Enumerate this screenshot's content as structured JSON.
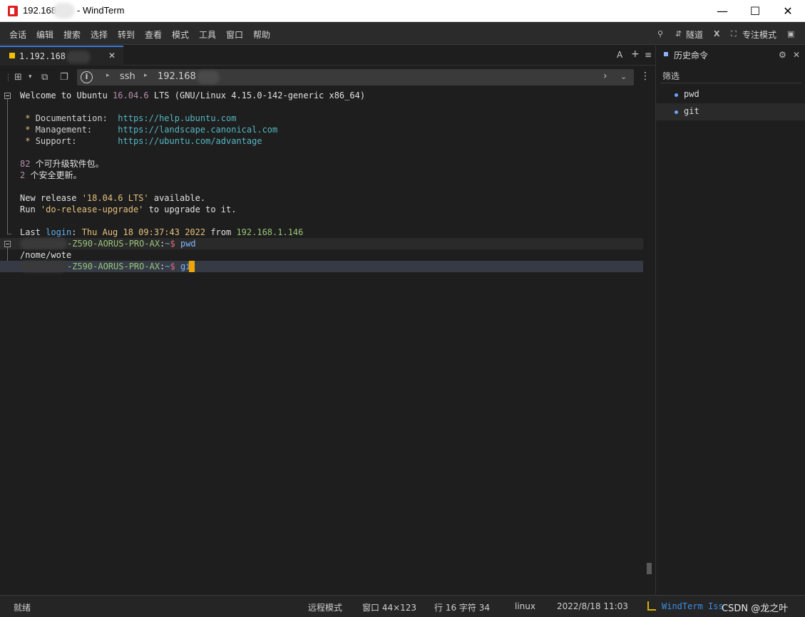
{
  "window": {
    "title_prefix": "192.168",
    "title_suffix": "- WindTerm",
    "minimize": "—",
    "maximize": "☐",
    "close": "✕"
  },
  "menu": {
    "items": [
      "会话",
      "编辑",
      "搜索",
      "选择",
      "转到",
      "查看",
      "模式",
      "工具",
      "窗口",
      "帮助"
    ],
    "tunnel_label": "隧道",
    "focus_label": "专注模式"
  },
  "tab": {
    "label": "1.192.168",
    "close": "✕",
    "font_icon": "A",
    "add_icon": "+",
    "menu_icon": "≡"
  },
  "address": {
    "info_icon": "i",
    "protocol": "ssh",
    "host": "192.168"
  },
  "terminal": {
    "welcome": {
      "a": "Welcome to Ubuntu ",
      "version": "16.04.6",
      "b": " LTS (GNU/Linux 4.15.0-142-generic x86_64)"
    },
    "docs": [
      {
        "star": " * ",
        "label": "Documentation:  ",
        "url": "https://help.ubuntu.com"
      },
      {
        "star": " * ",
        "label": "Management:     ",
        "url": "https://landscape.canonical.com"
      },
      {
        "star": " * ",
        "label": "Support:        ",
        "url": "https://ubuntu.com/advantage"
      }
    ],
    "updates": [
      {
        "count": "82",
        "text": " 个可升级软件包。"
      },
      {
        "count": "2",
        "text": " 个安全更新。"
      }
    ],
    "release": {
      "a": "New release ",
      "ver": "'18.04.6 LTS'",
      "b": " available."
    },
    "upgrade": {
      "a": "Run ",
      "cmd": "'do-release-upgrade'",
      "b": " to upgrade to it."
    },
    "last_login": {
      "a": "Last ",
      "login": "login",
      "colon": ": ",
      "date": "Thu Aug 18 09:37:43 2022",
      "from": " from ",
      "ip": "192.168.1.146"
    },
    "prompt_host": "-Z590-AORUS-PRO-AX",
    "prompt_sep": ":",
    "prompt_path": "~",
    "prompt_dollar": "$ ",
    "cmd1": "pwd",
    "output1": "/nome/wote",
    "cmd2": "git"
  },
  "history": {
    "title": "历史命令",
    "filter_label": "筛选",
    "items": [
      "pwd",
      "git"
    ]
  },
  "status": {
    "ready": "就绪",
    "mode": "远程模式",
    "window": "窗口 44×123",
    "position": "行 16 字符 34",
    "os": "linux",
    "datetime": "2022/8/18 11:03",
    "link": "WindTerm Iss",
    "watermark": "CSDN @龙之叶"
  },
  "colors": {
    "accent": "#3c78d8",
    "cursor": "#f0a500",
    "tab_dot": "#f2c200",
    "background": "#1e1e1e"
  }
}
